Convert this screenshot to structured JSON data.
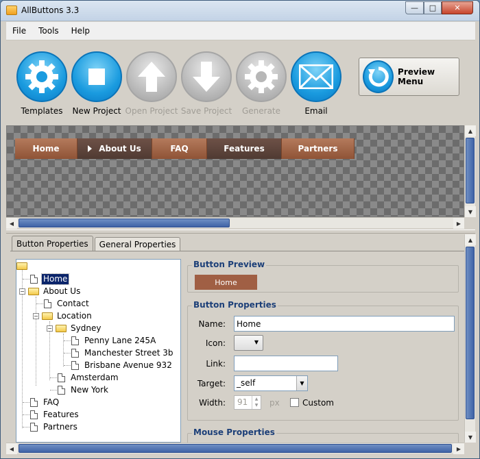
{
  "window": {
    "title": "AllButtons 3.3",
    "controls": {
      "minimize": "—",
      "maximize": "□",
      "close": "✕"
    }
  },
  "menu": [
    "File",
    "Tools",
    "Help"
  ],
  "toolbar": {
    "buttons": [
      {
        "label": "Templates",
        "icon": "gear-icon",
        "enabled": true
      },
      {
        "label": "New Project",
        "icon": "stop-square-icon",
        "enabled": true
      },
      {
        "label": "Open Project",
        "icon": "arrow-up-icon",
        "enabled": false
      },
      {
        "label": "Save Project",
        "icon": "arrow-down-icon",
        "enabled": false
      },
      {
        "label": "Generate",
        "icon": "gear-icon",
        "enabled": false
      },
      {
        "label": "Email",
        "icon": "envelope-icon",
        "enabled": true
      }
    ],
    "preview_menu": {
      "label": "Preview Menu",
      "icon": "refresh-icon"
    }
  },
  "preview_bar": {
    "items": [
      "Home",
      "About Us",
      "FAQ",
      "Features",
      "Partners"
    ],
    "active_index": 1,
    "colors": {
      "normal": "#a05f44",
      "active": "#5e453c"
    }
  },
  "tabs": [
    {
      "label": "Button Properties",
      "active": true
    },
    {
      "label": "General Properties",
      "active": false
    }
  ],
  "tree": {
    "nodes": [
      {
        "label": "",
        "type": "root-folder",
        "level": 0
      },
      {
        "label": "Home",
        "type": "file",
        "level": 1,
        "selected": true
      },
      {
        "label": "About Us",
        "type": "folder",
        "level": 1,
        "expanded": true
      },
      {
        "label": "Contact",
        "type": "file",
        "level": 2
      },
      {
        "label": "Location",
        "type": "folder",
        "level": 2,
        "expanded": true
      },
      {
        "label": "Sydney",
        "type": "folder",
        "level": 3,
        "expanded": true
      },
      {
        "label": "Penny Lane 245A",
        "type": "file",
        "level": 4
      },
      {
        "label": "Manchester Street 3b",
        "type": "file",
        "level": 4
      },
      {
        "label": "Brisbane Avenue 932",
        "type": "file",
        "level": 4
      },
      {
        "label": "Amsterdam",
        "type": "file",
        "level": 3
      },
      {
        "label": "New York",
        "type": "file",
        "level": 3
      },
      {
        "label": "FAQ",
        "type": "file",
        "level": 1
      },
      {
        "label": "Features",
        "type": "file",
        "level": 1
      },
      {
        "label": "Partners",
        "type": "file",
        "level": 1
      }
    ]
  },
  "button_preview": {
    "title": "Button Preview",
    "label": "Home",
    "color": "#a05f44"
  },
  "button_properties": {
    "title": "Button Properties",
    "name_label": "Name:",
    "name_value": "Home",
    "icon_label": "Icon:",
    "link_label": "Link:",
    "link_value": "",
    "target_label": "Target:",
    "target_value": "_self",
    "width_label": "Width:",
    "width_value": "91",
    "width_unit": "px",
    "custom_label": "Custom",
    "custom_checked": false
  },
  "mouse_properties": {
    "title": "Mouse Properties"
  }
}
